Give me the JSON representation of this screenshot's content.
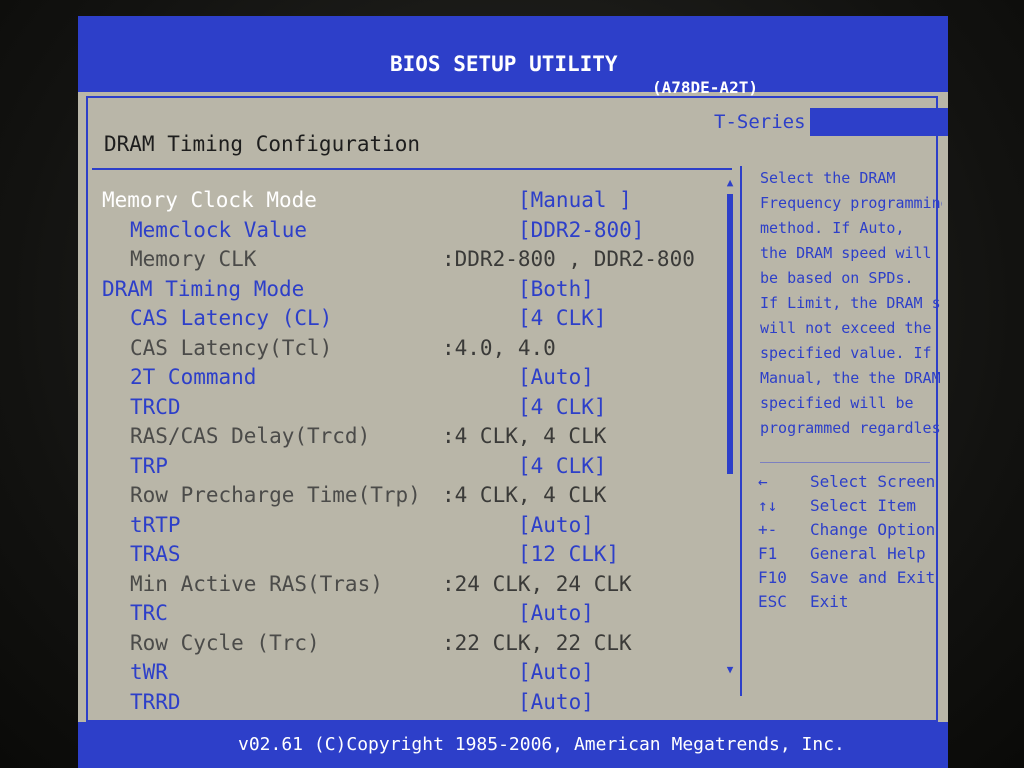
{
  "header": {
    "title": "BIOS SETUP UTILITY",
    "model": "(A78DE-A2T)",
    "series_tab": "T-Series"
  },
  "page": {
    "title": "DRAM Timing Configuration"
  },
  "settings": [
    {
      "label": "Memory Clock Mode",
      "value": "[Manual ]",
      "indent": 0,
      "state": "selected"
    },
    {
      "label": "Memclock Value",
      "value": "[DDR2-800]",
      "indent": 1,
      "state": "editable"
    },
    {
      "label": "Memory CLK",
      "value": ":DDR2-800 , DDR2-800",
      "indent": 1,
      "state": "readonly"
    },
    {
      "label": "DRAM Timing Mode",
      "value": "[Both]",
      "indent": 0,
      "state": "editable"
    },
    {
      "label": "CAS Latency (CL)",
      "value": "[4 CLK]",
      "indent": 1,
      "state": "editable"
    },
    {
      "label": "CAS Latency(Tcl)",
      "value": ":4.0, 4.0",
      "indent": 1,
      "state": "readonly"
    },
    {
      "label": "2T Command",
      "value": "[Auto]",
      "indent": 1,
      "state": "editable"
    },
    {
      "label": "TRCD",
      "value": "[4 CLK]",
      "indent": 1,
      "state": "editable"
    },
    {
      "label": "RAS/CAS Delay(Trcd)",
      "value": ":4 CLK, 4 CLK",
      "indent": 1,
      "state": "readonly"
    },
    {
      "label": "TRP",
      "value": "[4 CLK]",
      "indent": 1,
      "state": "editable"
    },
    {
      "label": "Row Precharge Time(Trp)",
      "value": ":4 CLK, 4 CLK",
      "indent": 1,
      "state": "readonly"
    },
    {
      "label": "tRTP",
      "value": "[Auto]",
      "indent": 1,
      "state": "editable"
    },
    {
      "label": "TRAS",
      "value": "[12 CLK]",
      "indent": 1,
      "state": "editable"
    },
    {
      "label": "Min Active RAS(Tras)",
      "value": ":24 CLK, 24 CLK",
      "indent": 1,
      "state": "readonly"
    },
    {
      "label": "TRC",
      "value": "[Auto]",
      "indent": 1,
      "state": "editable"
    },
    {
      "label": "Row Cycle (Trc)",
      "value": ":22 CLK, 22 CLK",
      "indent": 1,
      "state": "readonly"
    },
    {
      "label": "tWR",
      "value": "[Auto]",
      "indent": 1,
      "state": "editable"
    },
    {
      "label": "TRRD",
      "value": "[Auto]",
      "indent": 1,
      "state": "editable"
    }
  ],
  "help": {
    "lines": [
      "Select the DRAM",
      "Frequency programming",
      "method. If Auto,",
      "the DRAM speed will",
      "be based on SPDs.",
      "If Limit, the DRAM spe",
      "will not exceed the",
      "specified value. If",
      "Manual, the the DRAM s",
      "specified will be",
      "programmed regardless"
    ]
  },
  "keys": [
    {
      "glyph": "←",
      "desc": "Select Screen",
      "icon": "arrow-left-icon"
    },
    {
      "glyph": "↑↓",
      "desc": "Select Item",
      "icon": "arrow-updown-icon"
    },
    {
      "glyph": "+-",
      "desc": "Change Option",
      "icon": "plus-minus-icon"
    },
    {
      "glyph": "F1",
      "desc": "General Help",
      "icon": "f1-key-icon"
    },
    {
      "glyph": "F10",
      "desc": "Save and Exit",
      "icon": "f10-key-icon"
    },
    {
      "glyph": "ESC",
      "desc": "Exit",
      "icon": "esc-key-icon"
    }
  ],
  "footer": {
    "copyright": "v02.61 (C)Copyright 1985-2006, American Megatrends, Inc."
  },
  "colors": {
    "bios_blue": "#2d3fc9",
    "panel_gray": "#b9b6a8",
    "selected_text": "#ffffff"
  }
}
